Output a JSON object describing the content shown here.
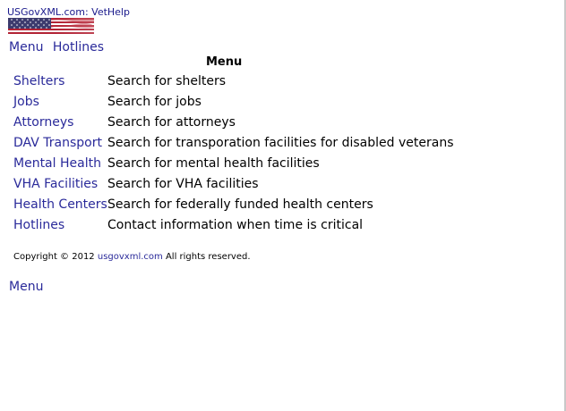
{
  "header": {
    "site_title": "USGovXML.com: VetHelp",
    "logo": "american-flag-icon"
  },
  "top_nav": [
    {
      "label": "Menu"
    },
    {
      "label": "Hotlines"
    }
  ],
  "menu": {
    "heading": "Menu",
    "items": [
      {
        "link": "Shelters",
        "description": "Search for shelters"
      },
      {
        "link": "Jobs",
        "description": "Search for jobs"
      },
      {
        "link": "Attorneys",
        "description": "Search for attorneys"
      },
      {
        "link": "DAV Transport",
        "description": "Search for transporation facilities for disabled veterans"
      },
      {
        "link": "Mental Health",
        "description": "Search for mental health facilities"
      },
      {
        "link": "VHA Facilities",
        "description": "Search for VHA facilities"
      },
      {
        "link": "Health Centers",
        "description": "Search for federally funded health centers"
      },
      {
        "link": "Hotlines",
        "description": "Contact information when time is critical"
      }
    ]
  },
  "footer": {
    "copyright_prefix": "Copyright © 2012",
    "copyright_link": "usgovxml.com",
    "copyright_suffix": "All rights reserved.",
    "bottom_menu": "Menu"
  },
  "colors": {
    "link": "#2a2a9a",
    "title": "#1a1a8c",
    "text": "#000000"
  }
}
